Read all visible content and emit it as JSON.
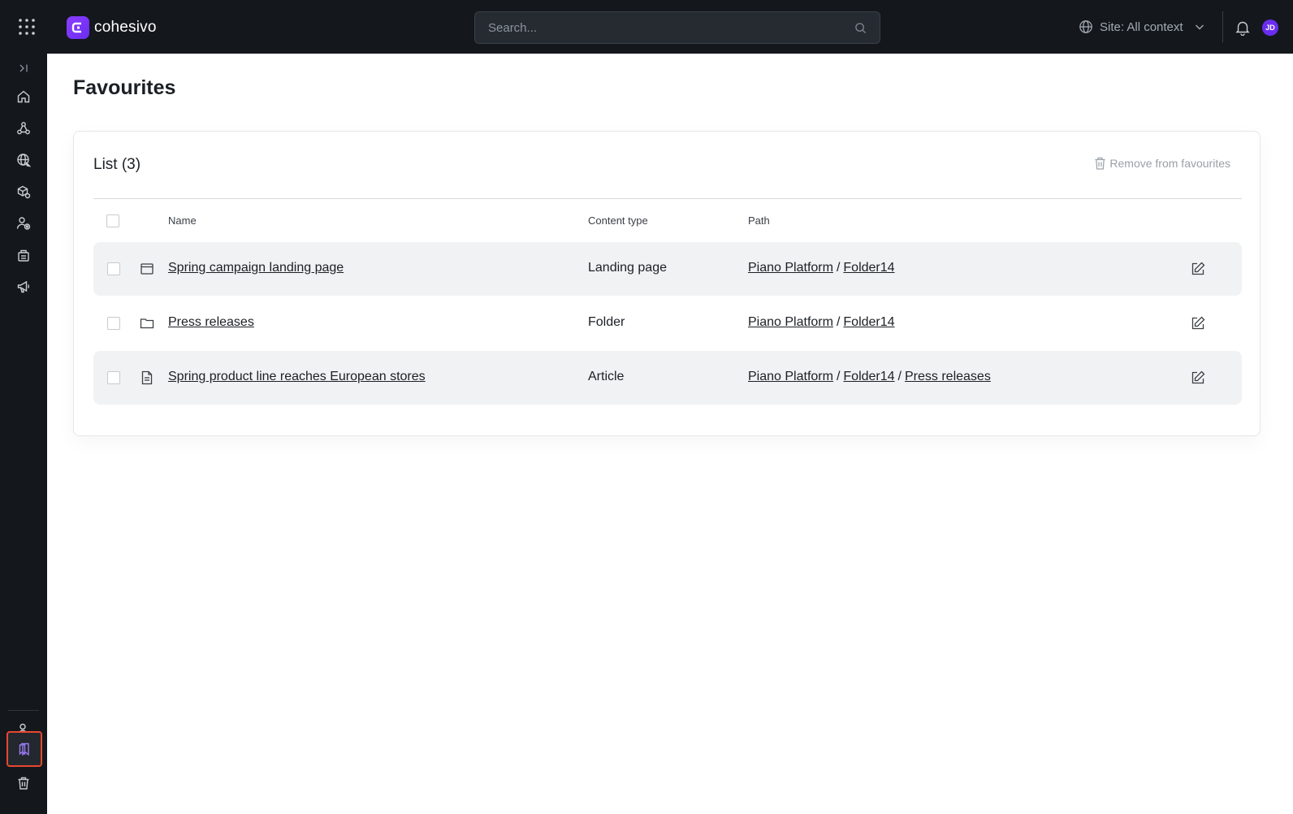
{
  "app": {
    "brand_name": "cohesivo"
  },
  "header": {
    "search_placeholder": "Search...",
    "site_selector_label": "Site: All context",
    "avatar_initials": "JD"
  },
  "page": {
    "title": "Favourites"
  },
  "list": {
    "title": "List (3)",
    "remove_label": "Remove from favourites",
    "columns": {
      "name": "Name",
      "content_type": "Content type",
      "path": "Path"
    },
    "rows": [
      {
        "icon": "landing-page-icon",
        "name": "Spring campaign landing page",
        "content_type": "Landing page",
        "path": [
          "Piano Platform",
          "Folder14"
        ]
      },
      {
        "icon": "folder-icon",
        "name": "Press releases",
        "content_type": "Folder",
        "path": [
          "Piano Platform",
          "Folder14"
        ]
      },
      {
        "icon": "article-icon",
        "name": "Spring product line reaches European stores",
        "content_type": "Article",
        "path": [
          "Piano Platform",
          "Folder14",
          "Press releases"
        ]
      }
    ]
  },
  "colors": {
    "topbar_bg": "#14181d",
    "brand_accent": "#6a2df0",
    "active_highlight": "#e8472f",
    "row_shade": "#f1f2f3"
  }
}
